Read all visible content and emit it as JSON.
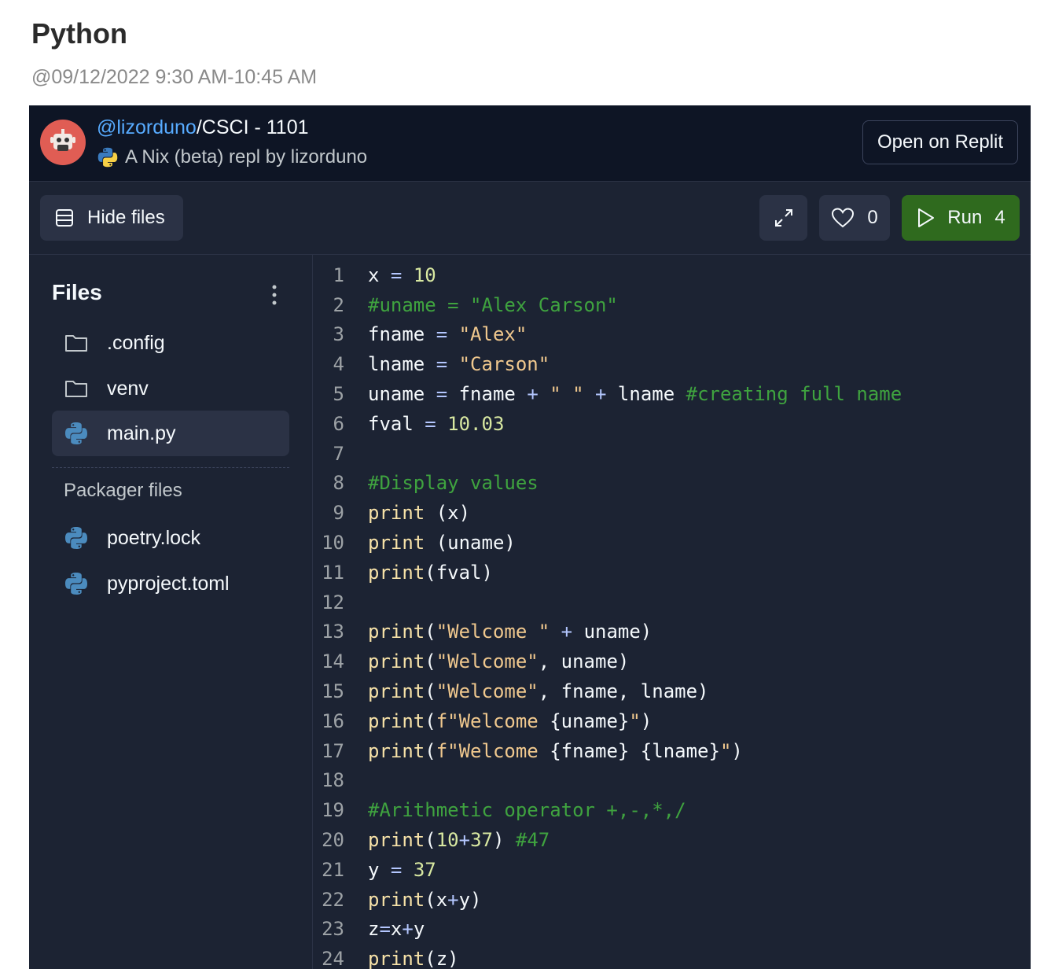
{
  "page": {
    "title": "Python",
    "date": "@09/12/2022 9:30 AM-10:45 AM"
  },
  "embed": {
    "user": "@lizorduno",
    "repl_name": "/CSCI - 1101",
    "subtitle": "A Nix (beta) repl by lizorduno",
    "open_label": "Open on Replit"
  },
  "toolbar": {
    "hide_files_label": "Hide files",
    "likes": "0",
    "run_label": "Run",
    "run_count": "4"
  },
  "sidebar": {
    "title": "Files",
    "files": [
      {
        "name": ".config",
        "icon": "folder-icon"
      },
      {
        "name": "venv",
        "icon": "folder-icon"
      },
      {
        "name": "main.py",
        "icon": "python-icon",
        "active": true
      }
    ],
    "packager_title": "Packager files",
    "packager_files": [
      {
        "name": "poetry.lock",
        "icon": "python-icon"
      },
      {
        "name": "pyproject.toml",
        "icon": "python-icon"
      }
    ]
  },
  "code": {
    "lines": [
      [
        [
          "var",
          "x "
        ],
        [
          "op",
          "= "
        ],
        [
          "num",
          "10"
        ]
      ],
      [
        [
          "cmt",
          "#uname = \"Alex Carson\""
        ]
      ],
      [
        [
          "var",
          "fname "
        ],
        [
          "op",
          "= "
        ],
        [
          "str",
          "\"Alex\""
        ]
      ],
      [
        [
          "var",
          "lname "
        ],
        [
          "op",
          "= "
        ],
        [
          "str",
          "\"Carson\""
        ]
      ],
      [
        [
          "var",
          "uname "
        ],
        [
          "op",
          "= "
        ],
        [
          "var",
          "fname "
        ],
        [
          "op",
          "+ "
        ],
        [
          "str",
          "\" \" "
        ],
        [
          "op",
          "+ "
        ],
        [
          "var",
          "lname "
        ],
        [
          "cmt",
          "#creating full name"
        ]
      ],
      [
        [
          "var",
          "fval "
        ],
        [
          "op",
          "= "
        ],
        [
          "num",
          "10.03"
        ]
      ],
      [],
      [
        [
          "cmt",
          "#Display values"
        ]
      ],
      [
        [
          "fn",
          "print "
        ],
        [
          "var",
          "(x)"
        ]
      ],
      [
        [
          "fn",
          "print "
        ],
        [
          "var",
          "(uname)"
        ]
      ],
      [
        [
          "fn",
          "print"
        ],
        [
          "var",
          "(fval)"
        ]
      ],
      [],
      [
        [
          "fn",
          "print"
        ],
        [
          "var",
          "("
        ],
        [
          "str",
          "\"Welcome \" "
        ],
        [
          "op",
          "+ "
        ],
        [
          "var",
          "uname)"
        ]
      ],
      [
        [
          "fn",
          "print"
        ],
        [
          "var",
          "("
        ],
        [
          "str",
          "\"Welcome\""
        ],
        [
          "var",
          ", uname)"
        ]
      ],
      [
        [
          "fn",
          "print"
        ],
        [
          "var",
          "("
        ],
        [
          "str",
          "\"Welcome\""
        ],
        [
          "var",
          ", fname, lname)"
        ]
      ],
      [
        [
          "fn",
          "print"
        ],
        [
          "var",
          "("
        ],
        [
          "str",
          "f\"Welcome "
        ],
        [
          "var",
          "{uname}"
        ],
        [
          "str",
          "\""
        ],
        [
          "var",
          ")"
        ]
      ],
      [
        [
          "fn",
          "print"
        ],
        [
          "var",
          "("
        ],
        [
          "str",
          "f\"Welcome "
        ],
        [
          "var",
          "{fname} {lname}"
        ],
        [
          "str",
          "\""
        ],
        [
          "var",
          ")"
        ]
      ],
      [],
      [
        [
          "cmt",
          "#Arithmetic operator +,-,*,/"
        ]
      ],
      [
        [
          "fn",
          "print"
        ],
        [
          "var",
          "("
        ],
        [
          "num",
          "10"
        ],
        [
          "op",
          "+"
        ],
        [
          "num",
          "37"
        ],
        [
          "var",
          ") "
        ],
        [
          "cmt",
          "#47"
        ]
      ],
      [
        [
          "var",
          "y "
        ],
        [
          "op",
          "= "
        ],
        [
          "num",
          "37"
        ]
      ],
      [
        [
          "fn",
          "print"
        ],
        [
          "var",
          "(x"
        ],
        [
          "op",
          "+"
        ],
        [
          "var",
          "y)"
        ]
      ],
      [
        [
          "var",
          "z"
        ],
        [
          "op",
          "="
        ],
        [
          "var",
          "x"
        ],
        [
          "op",
          "+"
        ],
        [
          "var",
          "y"
        ]
      ],
      [
        [
          "fn",
          "print"
        ],
        [
          "var",
          "(z)"
        ]
      ]
    ]
  },
  "colors": {
    "background": "#1c2333",
    "header_bg": "#0e1525",
    "run_green": "#2f6a1e",
    "link_blue": "#57abff",
    "avatar_red": "#e05d54"
  }
}
